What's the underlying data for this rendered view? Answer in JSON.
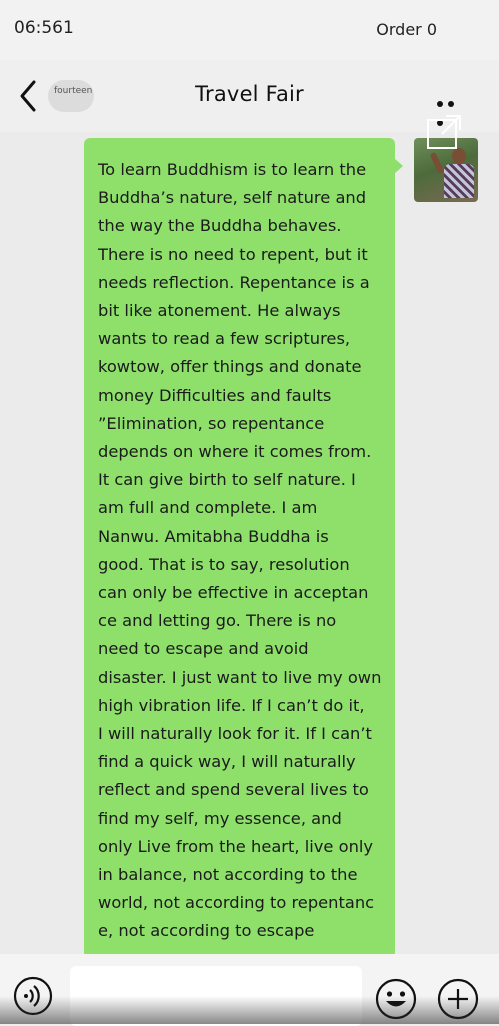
{
  "status_bar": {
    "time": "06:561",
    "order": "Order 0"
  },
  "header": {
    "back_icon": "chevron-left-icon",
    "unread_badge": "fourteen",
    "title": "Travel Fair",
    "more_icon": "more-dots-icon"
  },
  "message": {
    "text": "To learn Buddhism is to learn the\nBuddha’s nature, self nature and\nthe way the Buddha behaves.\nThere is no need to repent, but it\nneeds reflection. Repentance is a\nbit like atonement. He always\nwants to read a few scriptures,\nkowtow, offer things and donate\nmoney Difficulties and faults\n”Elimination, so repentance\ndepends on where it comes from.\nIt can give birth to self nature. I\nam full and complete. I am\nNanwu. Amitabha Buddha is\ngood. That is to say, resolution\ncan only be effective in acceptan\nce and letting go. There is no\nneed to escape and avoid\ndisaster. I just want to live my own\nhigh vibration life. If I can’t do it,\nI will naturally look for it. If I can’t\nfind a quick way, I will naturally\nreflect and spend several lives to\nfind my self, my essence, and\nonly Live from the heart, live only\nin balance, not according to the\nworld, not according to repentanc\ne, not according to escape",
    "bubble_color": "#8ee06b",
    "share_icon": "open-external-icon",
    "avatar": "sender-avatar"
  },
  "input_bar": {
    "voice_icon": "voice-icon",
    "text_value": "",
    "emoji_icon": "emoji-icon",
    "add_icon": "plus-circle-icon"
  }
}
